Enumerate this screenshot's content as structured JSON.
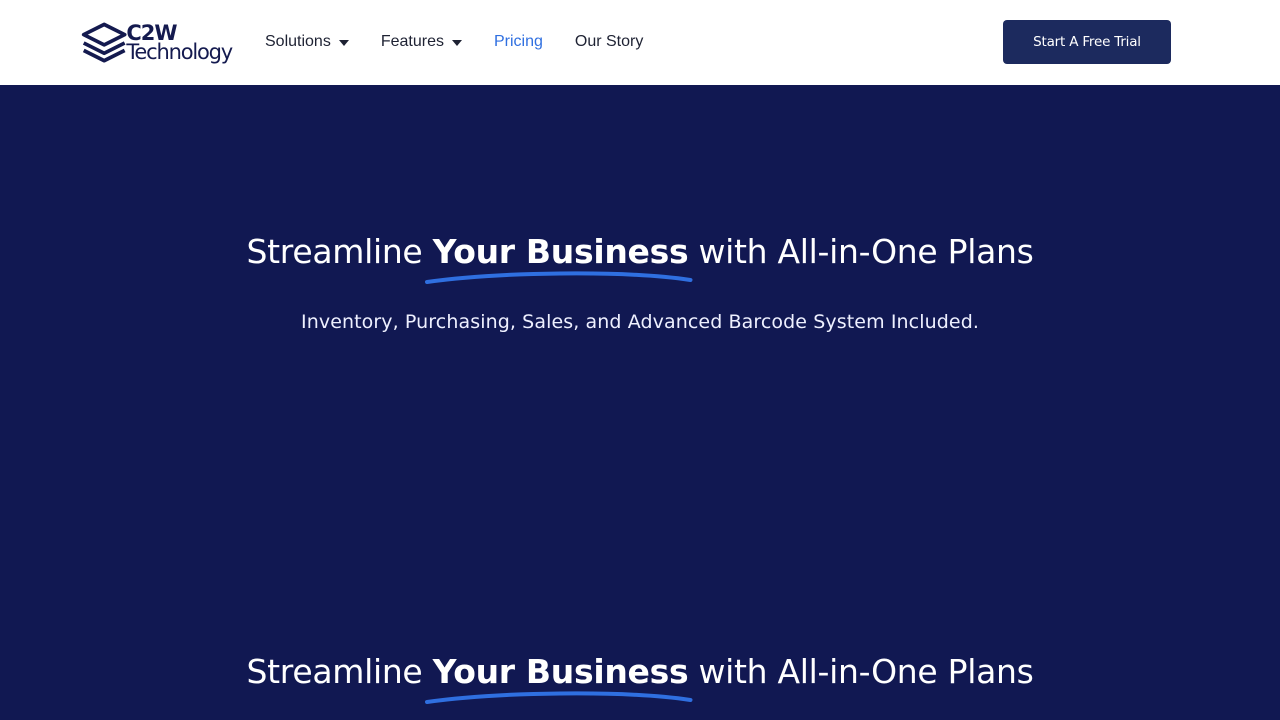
{
  "brand": {
    "logo_line1": "C2W",
    "logo_line2": "Technology",
    "logo_icon": "stacked-layers-icon",
    "color": "#141a4f"
  },
  "nav": {
    "items": [
      {
        "label": "Solutions",
        "has_dropdown": true
      },
      {
        "label": "Features",
        "has_dropdown": true
      },
      {
        "label": "Pricing",
        "active": true
      },
      {
        "label": "Our Story"
      }
    ],
    "active_color": "#2f6fe0"
  },
  "cta": {
    "label": "Start A Free Trial",
    "color": "#1c2a5e"
  },
  "hero": {
    "title_before": "Streamline ",
    "title_highlight": "Your Business",
    "title_after": " with All-in-One Plans",
    "subtitle": "Inventory, Purchasing, Sales, and Advanced Barcode System Included.",
    "background": "#111852",
    "underline_color": "#2f6fe0"
  }
}
